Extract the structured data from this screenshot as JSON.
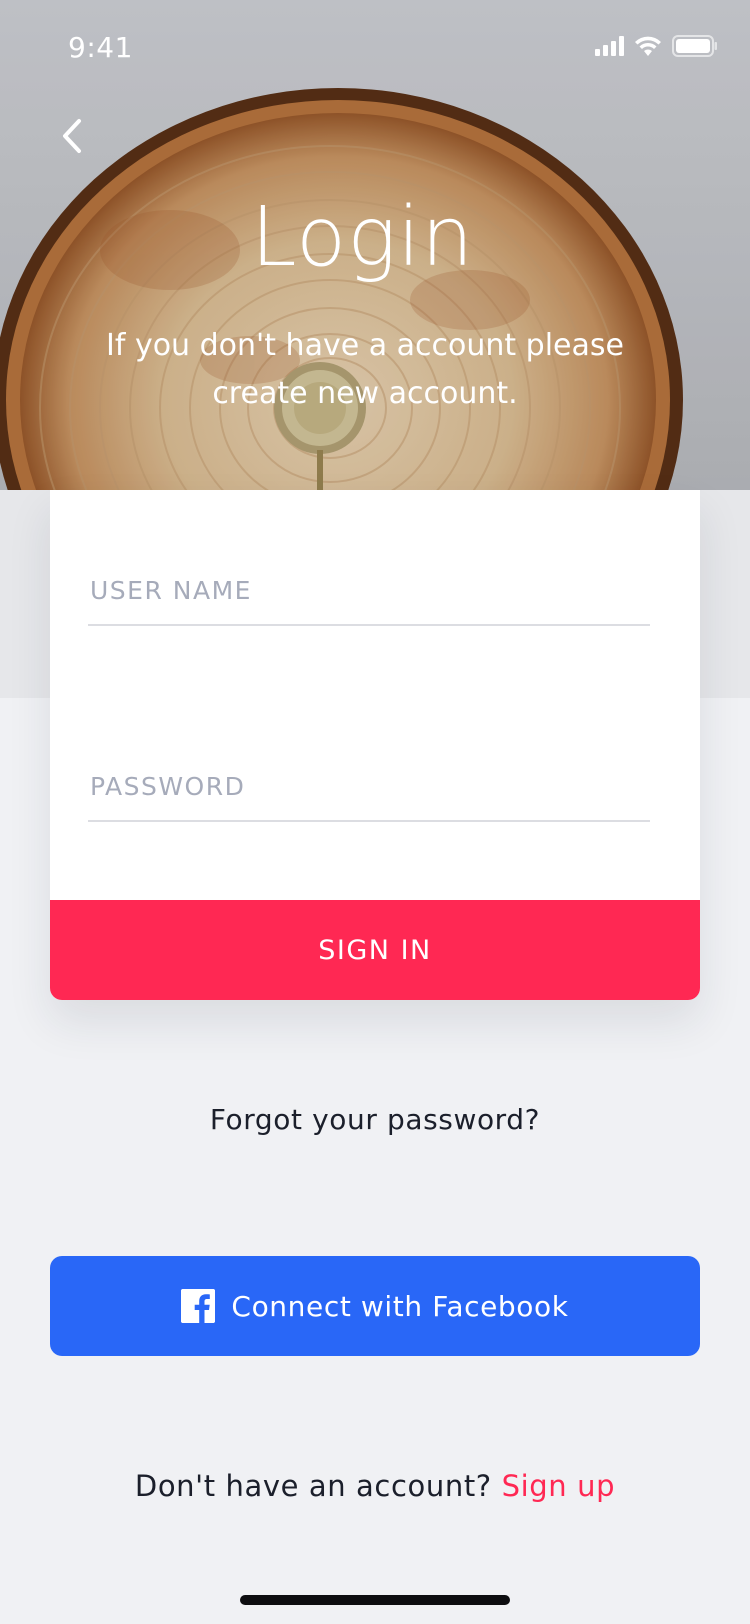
{
  "status_bar": {
    "time": "9:41"
  },
  "header": {
    "title": "Login",
    "subtitle": "If you don't have a account please create new account."
  },
  "form": {
    "username_placeholder": "USER NAME",
    "username_value": "",
    "password_placeholder": "PASSWORD",
    "password_value": "",
    "sign_in_label": "SIGN IN"
  },
  "links": {
    "forgot_password": "Forgot your password?",
    "facebook_label": "Connect with Facebook",
    "no_account_text": "Don't have an account?",
    "sign_up_label": "Sign up"
  },
  "colors": {
    "accent": "#ff2853",
    "facebook": "#2967f7",
    "background": "#f0f1f4"
  },
  "icons": {
    "back": "chevron-left-icon",
    "facebook": "facebook-icon",
    "signal": "cellular-signal-icon",
    "wifi": "wifi-icon",
    "battery": "battery-icon"
  }
}
